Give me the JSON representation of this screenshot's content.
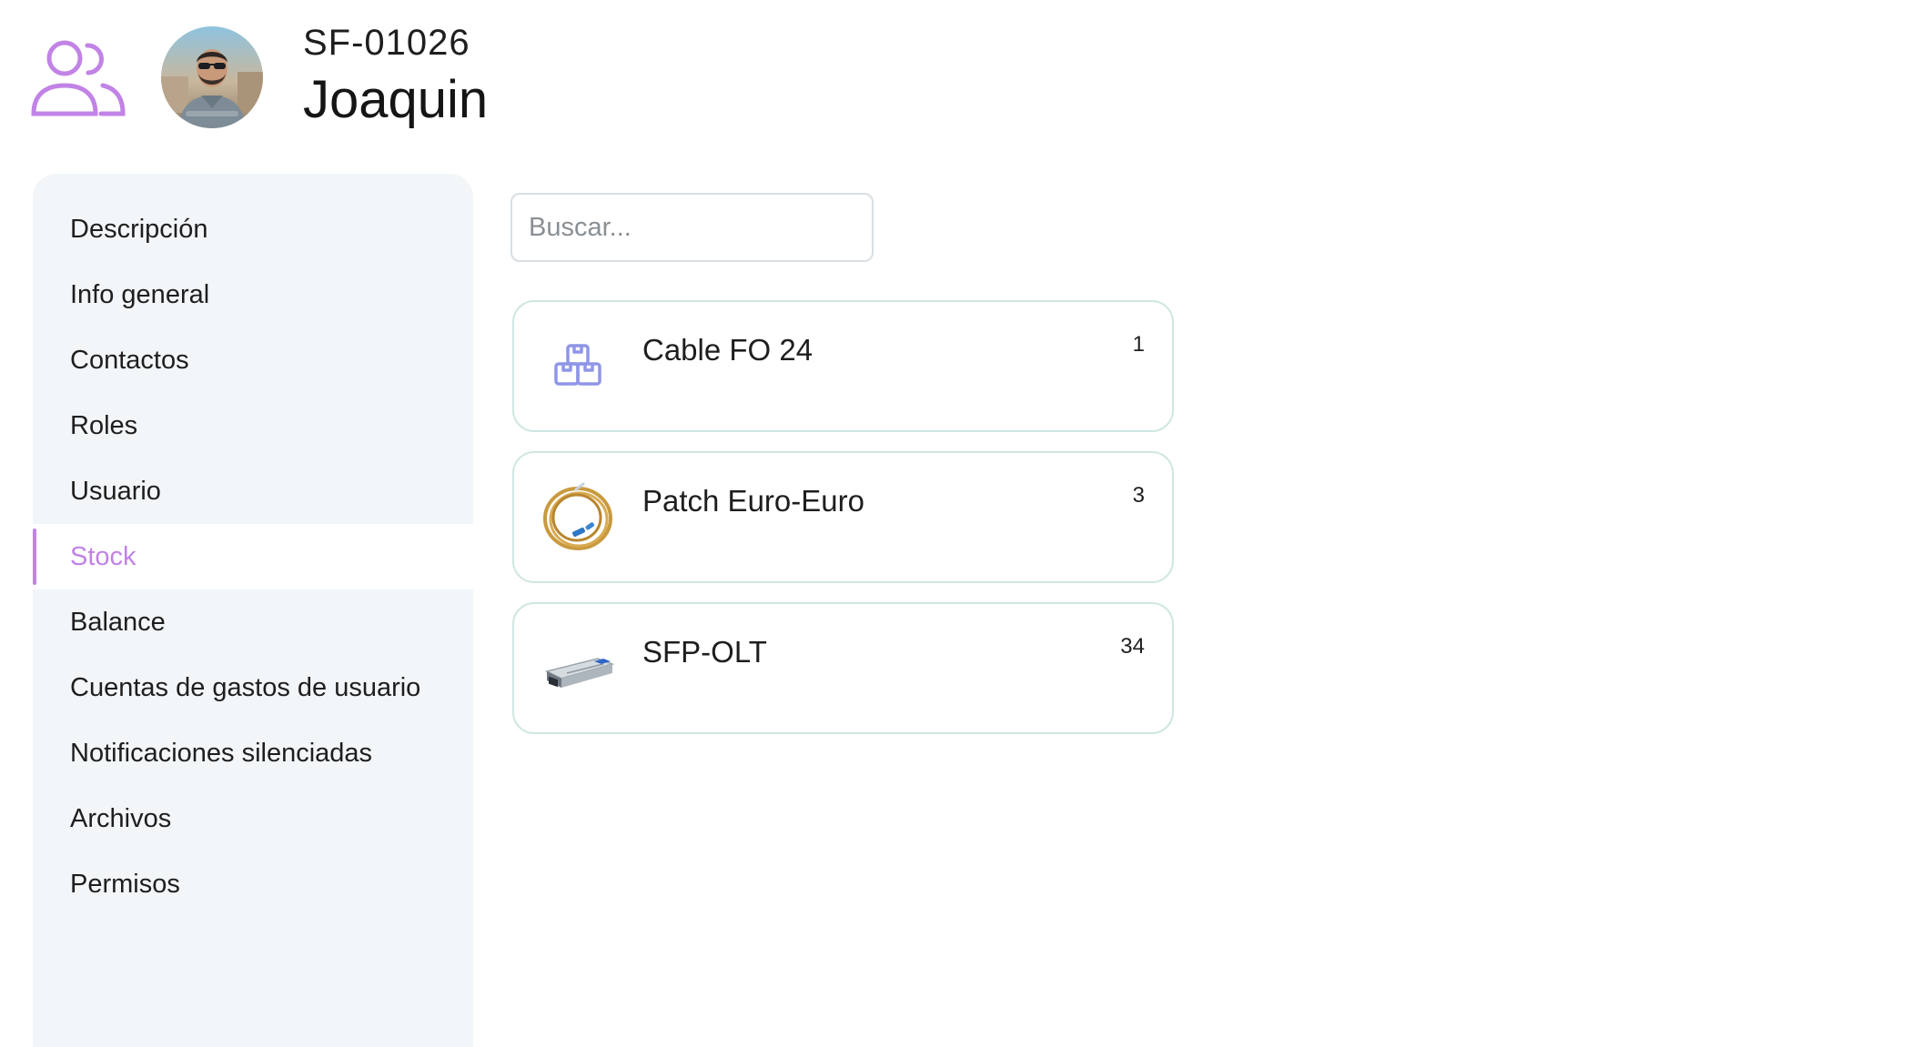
{
  "header": {
    "code": "SF-01026",
    "name": "Joaquin",
    "section_icon": "users-icon",
    "avatar": "user-photo"
  },
  "sidebar": {
    "items": [
      {
        "label": "Descripción",
        "active": false
      },
      {
        "label": "Info general",
        "active": false
      },
      {
        "label": "Contactos",
        "active": false
      },
      {
        "label": "Roles",
        "active": false
      },
      {
        "label": "Usuario",
        "active": false
      },
      {
        "label": "Stock",
        "active": true
      },
      {
        "label": "Balance",
        "active": false
      },
      {
        "label": "Cuentas de gastos de usuario",
        "active": false
      },
      {
        "label": "Notificaciones silenciadas",
        "active": false
      },
      {
        "label": "Archivos",
        "active": false
      },
      {
        "label": "Permisos",
        "active": false
      }
    ]
  },
  "search": {
    "placeholder": "Buscar...",
    "value": ""
  },
  "stock": {
    "items": [
      {
        "name": "Cable FO 24",
        "quantity": "1",
        "thumbnail": "boxes-icon"
      },
      {
        "name": "Patch Euro-Euro",
        "quantity": "3",
        "thumbnail": "patch-cable-image"
      },
      {
        "name": "SFP-OLT",
        "quantity": "34",
        "thumbnail": "sfp-module-image"
      }
    ]
  },
  "colors": {
    "accent": "#c183e5",
    "sidebar_bg": "#f2f6f8",
    "card_border": "#cfe7e3",
    "box_icon": "#8f95e8"
  }
}
